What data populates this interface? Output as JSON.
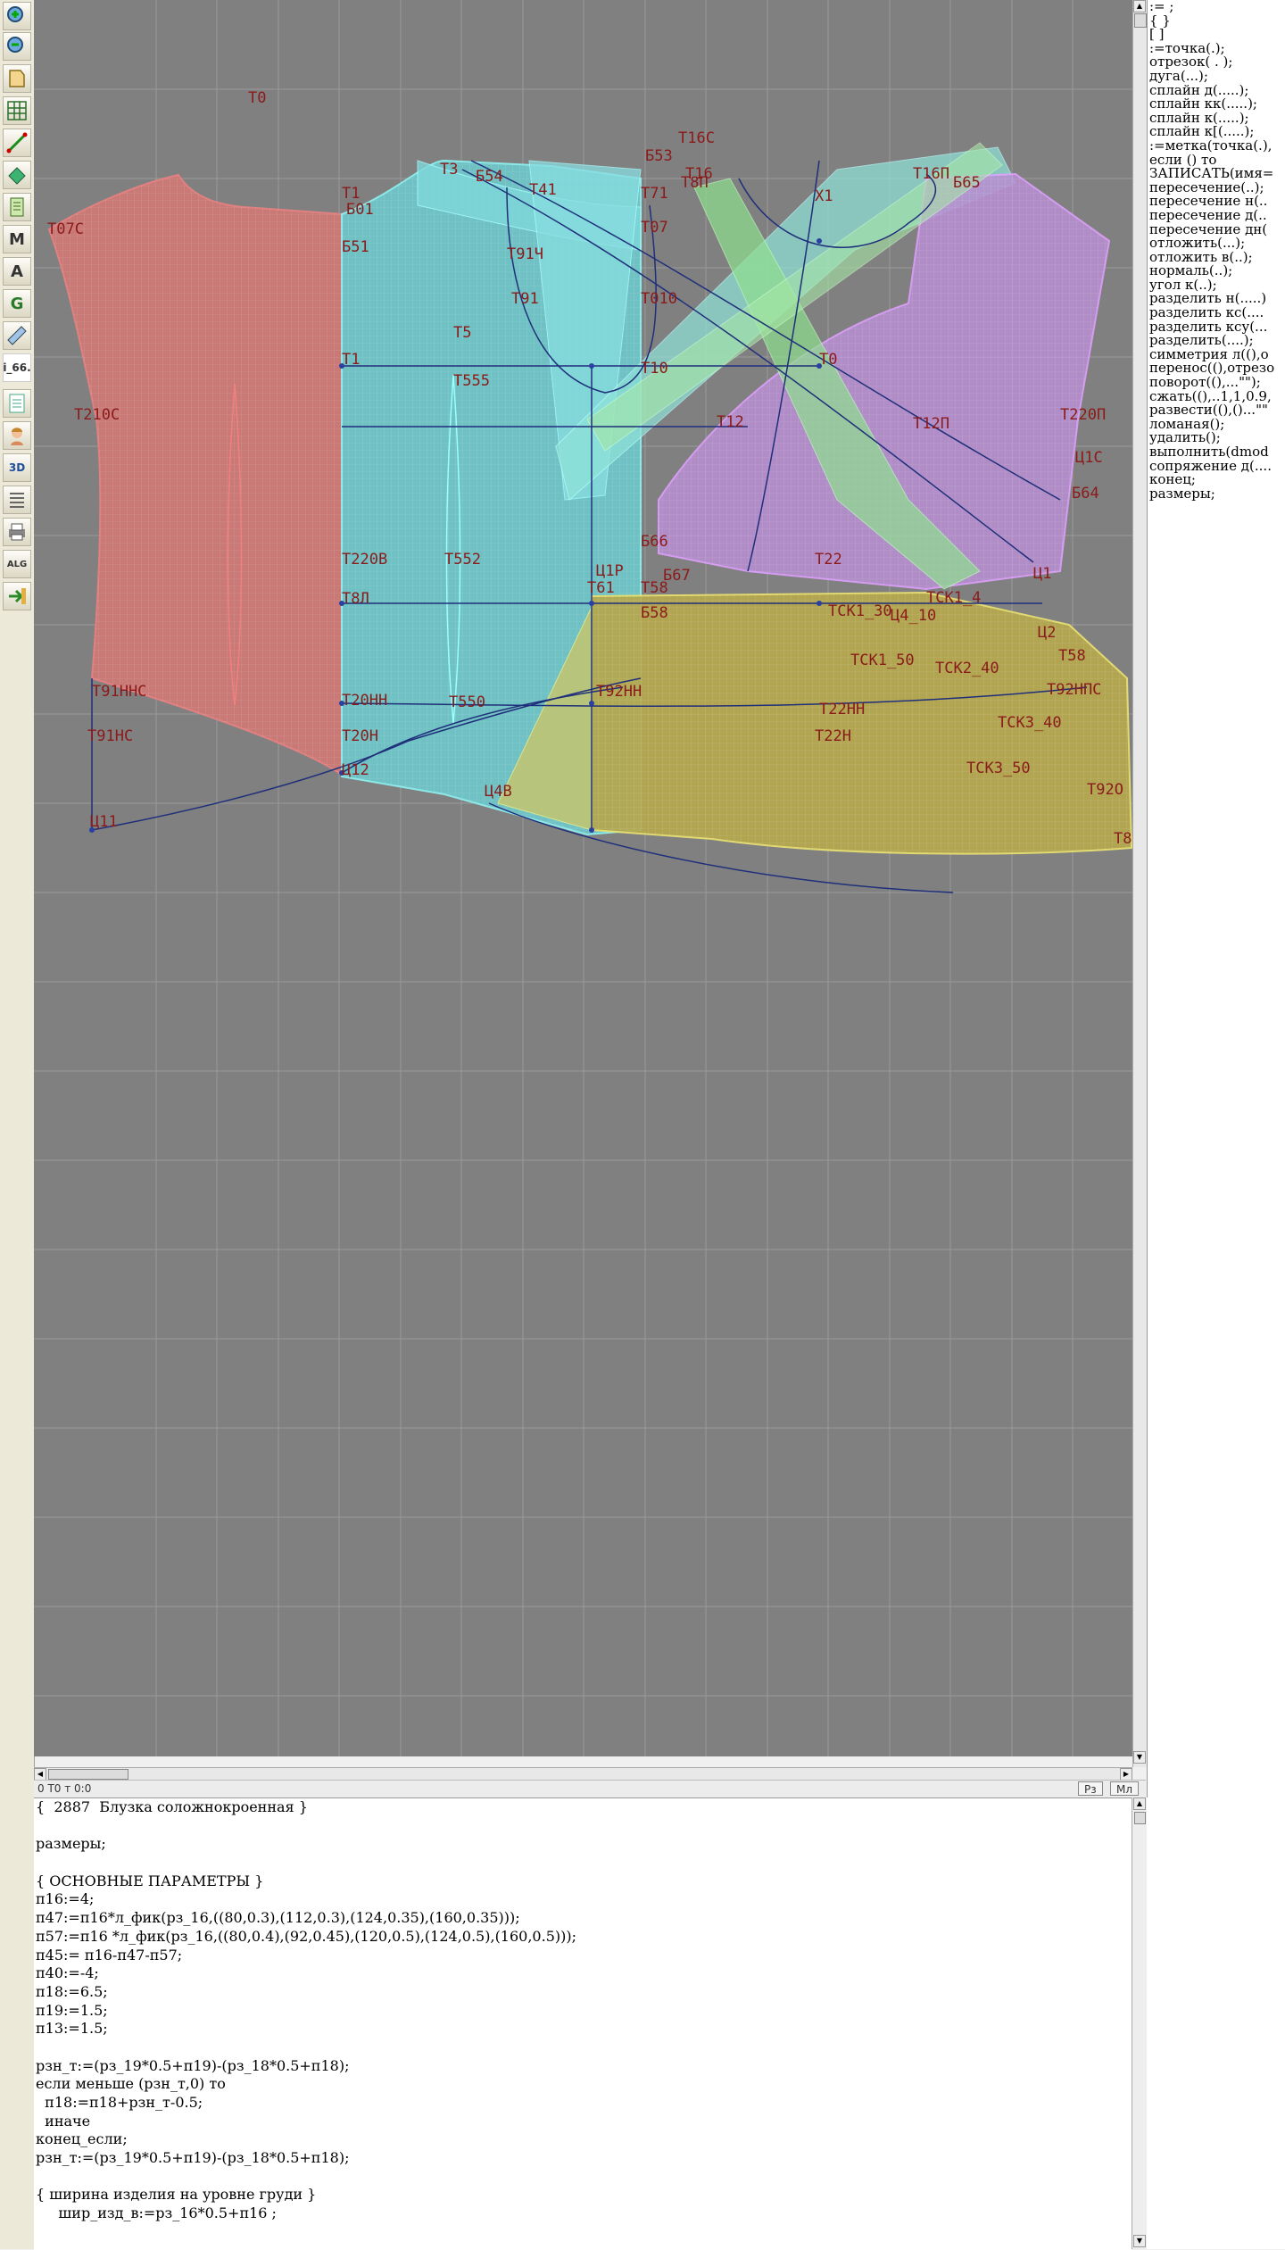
{
  "toolbar": {
    "tools": [
      {
        "name": "zoom-in-icon"
      },
      {
        "name": "zoom-out-icon"
      },
      {
        "name": "pattern-piece-icon"
      },
      {
        "name": "grid-icon"
      },
      {
        "name": "line-tool-icon"
      },
      {
        "name": "fill-icon"
      },
      {
        "name": "measure-icon"
      },
      {
        "name": "macro-icon",
        "text": "M"
      },
      {
        "name": "points-icon",
        "text": "A"
      },
      {
        "name": "gradation-icon",
        "text": "G"
      },
      {
        "name": "ruler-icon"
      },
      {
        "name": "version-label",
        "text": "i_66."
      },
      {
        "name": "new-document-icon"
      },
      {
        "name": "figure-icon"
      },
      {
        "name": "3d-view-icon",
        "text": "3D"
      },
      {
        "name": "list-icon"
      },
      {
        "name": "print-icon"
      },
      {
        "name": "alg-icon",
        "text": "ALG"
      },
      {
        "name": "export-icon"
      }
    ]
  },
  "canvas": {
    "labels": [
      "Т0",
      "Т3",
      "Б54",
      "Т41",
      "Т1",
      "Б01",
      "Б51",
      "Б53",
      "Т16С",
      "Т16",
      "Т8П",
      "Х1",
      "Т16П",
      "Б65",
      "Т07С",
      "Т71",
      "Т07",
      "Т91Ч",
      "Т91",
      "Т010",
      "Т5",
      "Т1",
      "Т555",
      "Т10",
      "Т0",
      "Т12",
      "Т210С",
      "Т220П",
      "Т12П",
      "Ц1С",
      "Б64",
      "Т220В",
      "Т552",
      "Т22",
      "Т8Л",
      "Т61",
      "Т58",
      "Б66",
      "Б67",
      "Ц1",
      "Т22НН",
      "Ц2",
      "ТСК1_30",
      "ТСК1_4",
      "Т20НН",
      "Т550",
      "Т91ННС",
      "Т91НС",
      "Т20Н",
      "Т22Н",
      "Ц12",
      "Ц4В",
      "Ц11",
      "Т92НПС",
      "ТСК3_50",
      "Т92О",
      "Т8",
      "Ц1Р",
      "ТСК2_40",
      "ТСК3_40",
      "Т58",
      "Б58",
      "ТСК1_50",
      "Ц4_10",
      "Т92НН"
    ]
  },
  "status": {
    "coords": "0  Т0 т 0:0",
    "btn_rz": "Рз",
    "btn_ml": "Мл"
  },
  "command_panel": {
    "items": [
      ":= ;",
      "{  }",
      "[   ]",
      ":=точка(.);",
      "отрезок( . );",
      "дуга(...);",
      "сплайн  д(.....);",
      "сплайн  кк(.....);",
      "сплайн  к(.....);",
      "сплайн  к[(.....);",
      ":=метка(точка(.),",
      "если () то",
      "ЗАПИСАТЬ(имя=",
      "пересечение(..);",
      "пересечение  н(..",
      "пересечение  д(..",
      "пересечение  дн(",
      "отложить(...);",
      "отложить  в(..);",
      "нормаль(..);",
      "угол  к(..);",
      "разделить  н(.....)",
      "разделить  кс(....",
      "разделить  ксу(...",
      "разделить(....);",
      "симметрия  л((),о",
      "перенос((),отрезо",
      "поворот((),...\"\");",
      "сжать((),..1,1,0.9,",
      "развести((),()...\"\"",
      "ломаная();",
      "удалить();",
      "выполнить(dmod",
      "сопряжение  д(....",
      "конец;",
      "размеры;"
    ]
  },
  "code": {
    "lines": [
      "{  2887  Блузка соложнокроенная }",
      "",
      "размеры;",
      "",
      "{ ОСНОВНЫЕ ПАРАМЕТРЫ }",
      "п16:=4;",
      "п47:=п16*л_фик(рз_16,((80,0.3),(112,0.3),(124,0.35),(160,0.35)));",
      "п57:=п16 *л_фик(рз_16,((80,0.4),(92,0.45),(120,0.5),(124,0.5),(160,0.5)));",
      "п45:= п16-п47-п57;",
      "п40:=-4;",
      "п18:=6.5;",
      "п19:=1.5;",
      "п13:=1.5;",
      "",
      "рзн_т:=(рз_19*0.5+п19)-(рз_18*0.5+п18);",
      "если меньше (рзн_т,0) то",
      "  п18:=п18+рзн_т-0.5;",
      "  иначе",
      "конец_если;",
      "рзн_т:=(рз_19*0.5+п19)-(рз_18*0.5+п18);",
      "",
      "{ ширина изделия на уровне груди }",
      "     шир_изд_в:=рз_16*0.5+п16 ;"
    ]
  }
}
